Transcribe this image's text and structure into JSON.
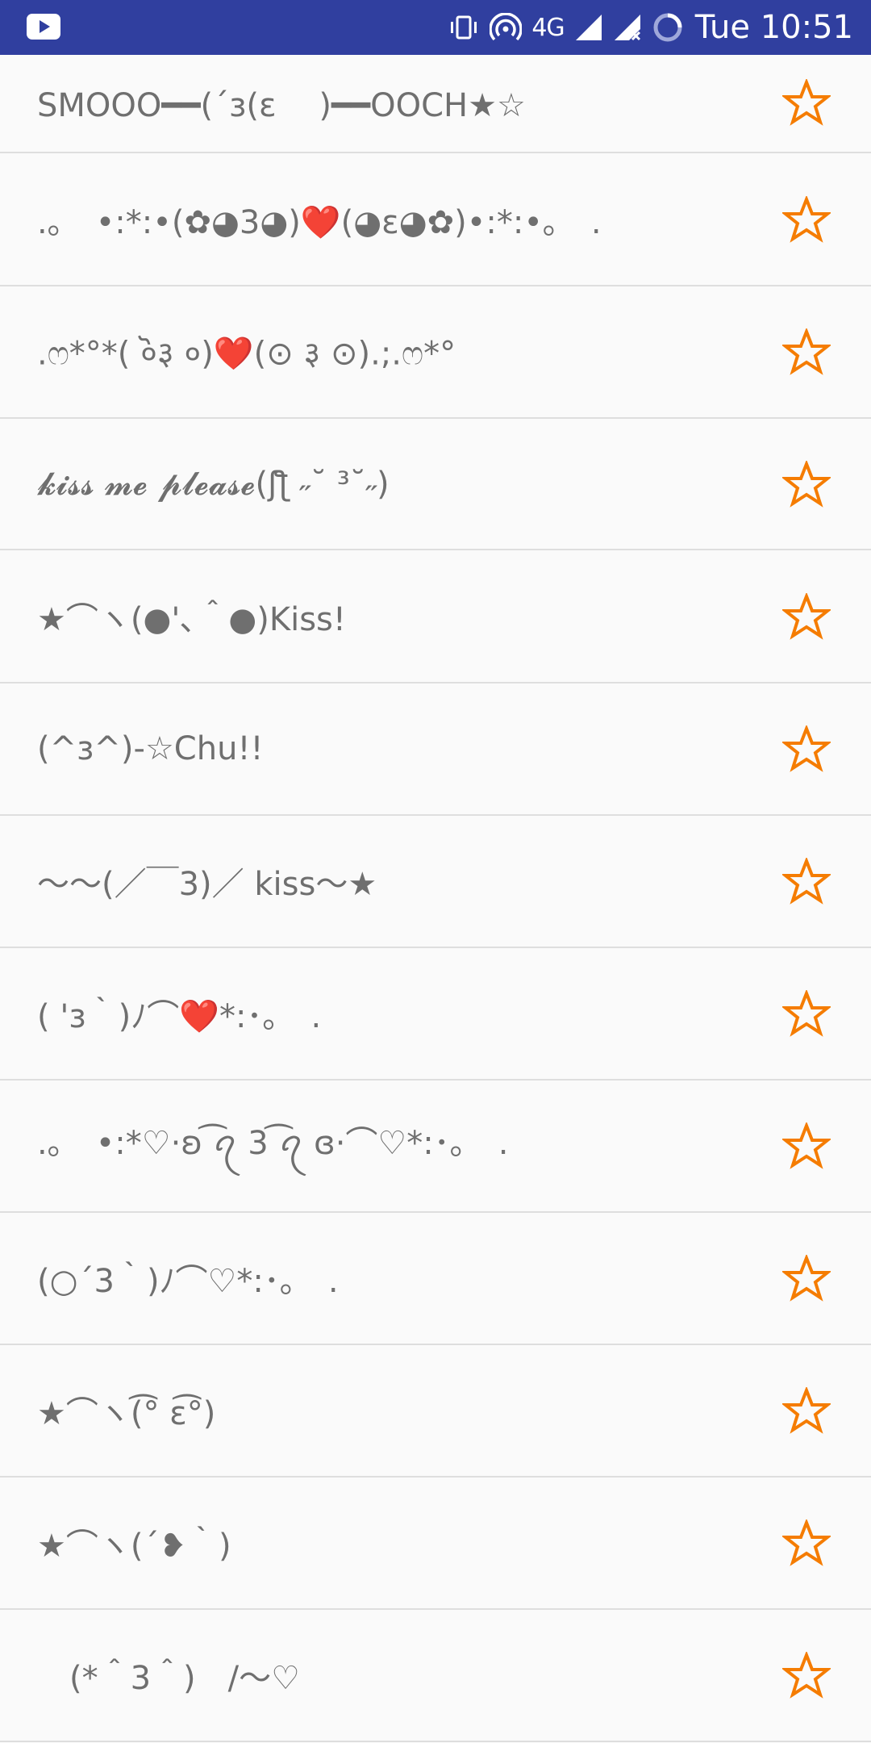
{
  "status_bar": {
    "network": "4G",
    "time": "Tue 10:51"
  },
  "colors": {
    "status_bar": "#303f9f",
    "star": "#f57c00",
    "text": "#6f6f6f",
    "divider": "#dedede"
  },
  "items": [
    {
      "text": "SMOOO━━(´з(ε　 )━━OOCH★☆",
      "favorite": false
    },
    {
      "text": ".｡　•:*:•(✿◕3◕)❤️(◕ε◕✿)•:*:•｡　.",
      "favorite": false
    },
    {
      "text": ".ෆ*°*( ०ॆ३ ०)❤️(⊙ ३ ⊙).;.ෆ*°",
      "favorite": false
    },
    {
      "text": "𝓴𝓲𝓼𝓼 𝓶𝓮 𝓹𝓵𝓮𝓪𝓼𝓮(ʃƪ ˶˘ ³˘˶)",
      "favorite": false
    },
    {
      "text": "★⌒ヽ(●'､＾●)Kiss!",
      "favorite": false
    },
    {
      "text": "(^з^)-☆Chu!!",
      "favorite": false
    },
    {
      "text": "～～(／￣3)／ kiss～★",
      "favorite": false
    },
    {
      "text": "( 'з｀)ﾉ⌒❤️*:･｡　.",
      "favorite": false
    },
    {
      "text": ".｡　•:*♡·ʚ ͡ꪖ 3 ͡ꪖ ɞ·⌒♡*:･｡　.",
      "favorite": false
    },
    {
      "text": "(○´3｀)ﾉ⌒♡*:･｡　.",
      "favorite": false
    },
    {
      "text": "★⌒ヽ(͡° ε͡°)",
      "favorite": false
    },
    {
      "text": "★⌒ヽ(´❥｀)",
      "favorite": false
    },
    {
      "text": "　(*＾3＾)　/～♡",
      "favorite": false
    }
  ]
}
